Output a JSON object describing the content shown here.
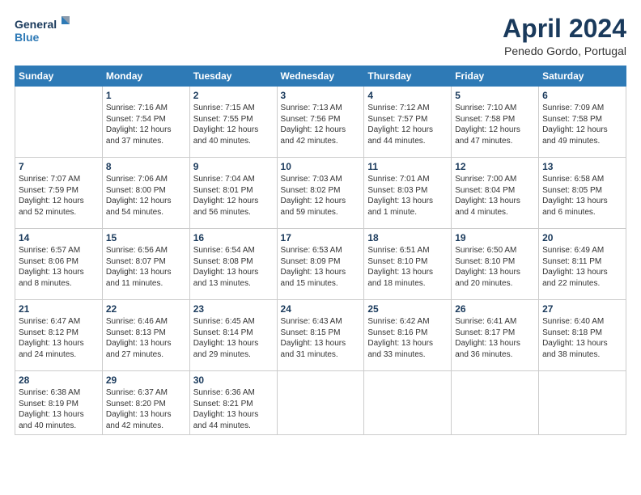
{
  "logo": {
    "line1": "General",
    "line2": "Blue"
  },
  "title": "April 2024",
  "location": "Penedo Gordo, Portugal",
  "weekdays": [
    "Sunday",
    "Monday",
    "Tuesday",
    "Wednesday",
    "Thursday",
    "Friday",
    "Saturday"
  ],
  "weeks": [
    [
      {
        "day": "",
        "info": ""
      },
      {
        "day": "1",
        "info": "Sunrise: 7:16 AM\nSunset: 7:54 PM\nDaylight: 12 hours\nand 37 minutes."
      },
      {
        "day": "2",
        "info": "Sunrise: 7:15 AM\nSunset: 7:55 PM\nDaylight: 12 hours\nand 40 minutes."
      },
      {
        "day": "3",
        "info": "Sunrise: 7:13 AM\nSunset: 7:56 PM\nDaylight: 12 hours\nand 42 minutes."
      },
      {
        "day": "4",
        "info": "Sunrise: 7:12 AM\nSunset: 7:57 PM\nDaylight: 12 hours\nand 44 minutes."
      },
      {
        "day": "5",
        "info": "Sunrise: 7:10 AM\nSunset: 7:58 PM\nDaylight: 12 hours\nand 47 minutes."
      },
      {
        "day": "6",
        "info": "Sunrise: 7:09 AM\nSunset: 7:58 PM\nDaylight: 12 hours\nand 49 minutes."
      }
    ],
    [
      {
        "day": "7",
        "info": "Sunrise: 7:07 AM\nSunset: 7:59 PM\nDaylight: 12 hours\nand 52 minutes."
      },
      {
        "day": "8",
        "info": "Sunrise: 7:06 AM\nSunset: 8:00 PM\nDaylight: 12 hours\nand 54 minutes."
      },
      {
        "day": "9",
        "info": "Sunrise: 7:04 AM\nSunset: 8:01 PM\nDaylight: 12 hours\nand 56 minutes."
      },
      {
        "day": "10",
        "info": "Sunrise: 7:03 AM\nSunset: 8:02 PM\nDaylight: 12 hours\nand 59 minutes."
      },
      {
        "day": "11",
        "info": "Sunrise: 7:01 AM\nSunset: 8:03 PM\nDaylight: 13 hours\nand 1 minute."
      },
      {
        "day": "12",
        "info": "Sunrise: 7:00 AM\nSunset: 8:04 PM\nDaylight: 13 hours\nand 4 minutes."
      },
      {
        "day": "13",
        "info": "Sunrise: 6:58 AM\nSunset: 8:05 PM\nDaylight: 13 hours\nand 6 minutes."
      }
    ],
    [
      {
        "day": "14",
        "info": "Sunrise: 6:57 AM\nSunset: 8:06 PM\nDaylight: 13 hours\nand 8 minutes."
      },
      {
        "day": "15",
        "info": "Sunrise: 6:56 AM\nSunset: 8:07 PM\nDaylight: 13 hours\nand 11 minutes."
      },
      {
        "day": "16",
        "info": "Sunrise: 6:54 AM\nSunset: 8:08 PM\nDaylight: 13 hours\nand 13 minutes."
      },
      {
        "day": "17",
        "info": "Sunrise: 6:53 AM\nSunset: 8:09 PM\nDaylight: 13 hours\nand 15 minutes."
      },
      {
        "day": "18",
        "info": "Sunrise: 6:51 AM\nSunset: 8:10 PM\nDaylight: 13 hours\nand 18 minutes."
      },
      {
        "day": "19",
        "info": "Sunrise: 6:50 AM\nSunset: 8:10 PM\nDaylight: 13 hours\nand 20 minutes."
      },
      {
        "day": "20",
        "info": "Sunrise: 6:49 AM\nSunset: 8:11 PM\nDaylight: 13 hours\nand 22 minutes."
      }
    ],
    [
      {
        "day": "21",
        "info": "Sunrise: 6:47 AM\nSunset: 8:12 PM\nDaylight: 13 hours\nand 24 minutes."
      },
      {
        "day": "22",
        "info": "Sunrise: 6:46 AM\nSunset: 8:13 PM\nDaylight: 13 hours\nand 27 minutes."
      },
      {
        "day": "23",
        "info": "Sunrise: 6:45 AM\nSunset: 8:14 PM\nDaylight: 13 hours\nand 29 minutes."
      },
      {
        "day": "24",
        "info": "Sunrise: 6:43 AM\nSunset: 8:15 PM\nDaylight: 13 hours\nand 31 minutes."
      },
      {
        "day": "25",
        "info": "Sunrise: 6:42 AM\nSunset: 8:16 PM\nDaylight: 13 hours\nand 33 minutes."
      },
      {
        "day": "26",
        "info": "Sunrise: 6:41 AM\nSunset: 8:17 PM\nDaylight: 13 hours\nand 36 minutes."
      },
      {
        "day": "27",
        "info": "Sunrise: 6:40 AM\nSunset: 8:18 PM\nDaylight: 13 hours\nand 38 minutes."
      }
    ],
    [
      {
        "day": "28",
        "info": "Sunrise: 6:38 AM\nSunset: 8:19 PM\nDaylight: 13 hours\nand 40 minutes."
      },
      {
        "day": "29",
        "info": "Sunrise: 6:37 AM\nSunset: 8:20 PM\nDaylight: 13 hours\nand 42 minutes."
      },
      {
        "day": "30",
        "info": "Sunrise: 6:36 AM\nSunset: 8:21 PM\nDaylight: 13 hours\nand 44 minutes."
      },
      {
        "day": "",
        "info": ""
      },
      {
        "day": "",
        "info": ""
      },
      {
        "day": "",
        "info": ""
      },
      {
        "day": "",
        "info": ""
      }
    ]
  ]
}
